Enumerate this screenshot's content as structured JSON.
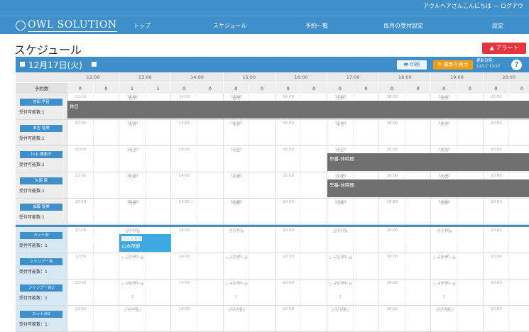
{
  "header": {
    "greeting": "アウルヘアさんこんにちは — ログアウ",
    "logo_text": "OWL SOLUTION",
    "nav": [
      "トップ",
      "スケジュール",
      "予約一覧",
      "毎月の受付設定",
      "設定"
    ]
  },
  "page": {
    "title": "スケジュール",
    "alert_label": "アラート"
  },
  "datebar": {
    "date": "12月17日(火)",
    "print_label": "印刷",
    "refresh_label": "最新を表示",
    "updated_label": "更新日時：",
    "updated_time": "12/17 13:27"
  },
  "hours": [
    "12:00",
    "13:00",
    "14:00",
    "15:00",
    "16:00",
    "17:00",
    "18:00",
    "19:00",
    "20:00"
  ],
  "counts": {
    "label": "予約数",
    "values": [
      "0",
      "0",
      "1",
      "1",
      "0",
      "0",
      "0",
      "0",
      "0",
      "0",
      "0",
      "0",
      "0",
      "0",
      "0",
      "0",
      "0",
      "0"
    ]
  },
  "staff_rows": [
    {
      "name": "吉田 早苗",
      "avail": "受付可能数:1",
      "sub": "吉田",
      "block": {
        "label": "休日"
      }
    },
    {
      "name": "末吉 智美",
      "avail": "受付可能数:1",
      "sub": "末吉"
    },
    {
      "name": "川上 理恵子",
      "avail": "受付可能数:1",
      "sub": "川上",
      "block": {
        "label": "早番-休時間"
      }
    },
    {
      "name": "久保 恵",
      "avail": "受付可能数:1",
      "sub": "久保",
      "block": {
        "label": "早番-休時間"
      }
    },
    {
      "name": "加藤 智美",
      "avail": "受付可能数:1",
      "sub": "加藤"
    }
  ],
  "resource_rows": [
    {
      "name": "カット台",
      "avail": "受付可能数：1",
      "sub": "カット台",
      "appt": {
        "tag": "ヘッドスパ",
        "customer": "山本茂樹"
      }
    },
    {
      "name": "シャンプー台",
      "avail": "受付可能数：1",
      "sub": "シャンプー台"
    },
    {
      "name": "シャンプー台2",
      "avail": "受付可能数：1",
      "sub": "シャンプー台",
      "sub2": "2"
    },
    {
      "name": "カット台2",
      "avail": "受付可能数：1",
      "sub": "カット台2"
    }
  ]
}
